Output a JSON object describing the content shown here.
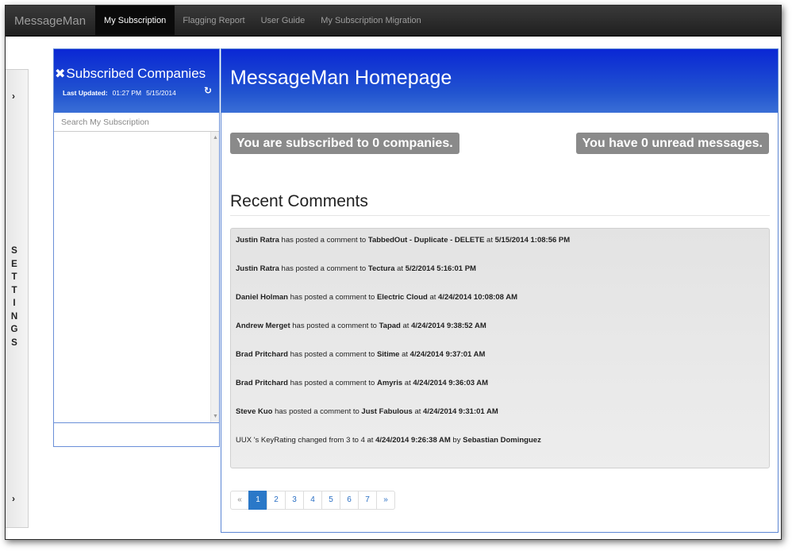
{
  "navbar": {
    "brand": "MessageMan",
    "items": [
      {
        "label": "My Subscription",
        "active": true
      },
      {
        "label": "Flagging Report",
        "active": false
      },
      {
        "label": "User Guide",
        "active": false
      },
      {
        "label": "My Subscription Migration",
        "active": false
      }
    ]
  },
  "settings": {
    "letters": [
      "S",
      "E",
      "T",
      "T",
      "I",
      "N",
      "G",
      "S"
    ],
    "arrow": "›"
  },
  "subscribed": {
    "title": "Subscribed Companies",
    "close_glyph": "✖",
    "updated_label": "Last Updated:",
    "updated_time": "01:27 PM",
    "updated_date": "5/15/2014",
    "refresh_glyph": "↻",
    "search_placeholder": "Search My Subscription"
  },
  "main": {
    "title": "MessageMan Homepage",
    "subscribed_badge": "You are subscribed to 0 companies.",
    "unread_badge": "You have 0 unread messages.",
    "recent_title": "Recent Comments"
  },
  "comments": [
    {
      "who": "Justin Ratra",
      "mid": " has posted a comment to ",
      "target": "TabbedOut - Duplicate - DELETE",
      "at": " at ",
      "when": "5/15/2014 1:08:56 PM"
    },
    {
      "who": "Justin Ratra",
      "mid": " has posted a comment to ",
      "target": "Tectura",
      "at": " at ",
      "when": "5/2/2014 5:16:01 PM"
    },
    {
      "who": "Daniel Holman",
      "mid": " has posted a comment to ",
      "target": "Electric Cloud",
      "at": " at ",
      "when": "4/24/2014 10:08:08 AM"
    },
    {
      "who": "Andrew Merget",
      "mid": " has posted a comment to ",
      "target": "Tapad",
      "at": " at ",
      "when": "4/24/2014 9:38:52 AM"
    },
    {
      "who": "Brad Pritchard",
      "mid": " has posted a comment to ",
      "target": "Sitime",
      "at": " at ",
      "when": "4/24/2014 9:37:01 AM"
    },
    {
      "who": "Brad Pritchard",
      "mid": " has posted a comment to ",
      "target": "Amyris",
      "at": " at ",
      "when": "4/24/2014 9:36:03 AM"
    },
    {
      "who": "Steve Kuo",
      "mid": " has posted a comment to ",
      "target": "Just Fabulous",
      "at": " at ",
      "when": "4/24/2014 9:31:01 AM"
    }
  ],
  "keyrating": {
    "company": "UUX",
    "text": " 's KeyRating changed from 3 to 4 at ",
    "when": "4/24/2014 9:26:38 AM",
    "by": " by ",
    "user": "Sebastian Dominguez"
  },
  "pagination": {
    "prev": "«",
    "pages": [
      "1",
      "2",
      "3",
      "4",
      "5",
      "6",
      "7"
    ],
    "active": "1",
    "next": "»"
  }
}
